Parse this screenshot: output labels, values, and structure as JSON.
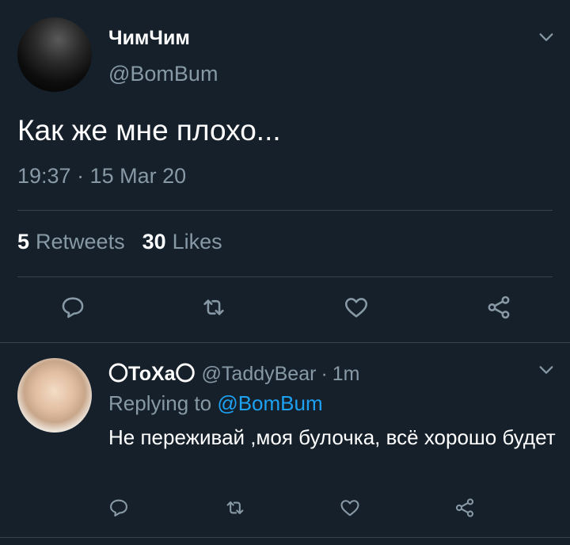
{
  "tweet": {
    "display_name": "ЧимЧим",
    "handle": "@BomBum",
    "text": "Как же мне плохо...",
    "timestamp": "19:37 · 15 Mar 20",
    "retweets_count": "5",
    "retweets_label": "Retweets",
    "likes_count": "30",
    "likes_label": "Likes"
  },
  "reply": {
    "display_name": "〇ТоХа〇",
    "handle": "@TaddyBear",
    "separator": "·",
    "time": "1m",
    "replying_prefix": "Replying to",
    "replying_to": "@BomBum",
    "text": "Не переживай ,моя булочка, всё хорошо будет"
  },
  "icons": {
    "more": "chevron-down-icon",
    "reply": "reply-bubble-icon",
    "retweet": "retweet-icon",
    "like": "heart-icon",
    "share": "share-icon"
  },
  "colors": {
    "background": "#15202b",
    "secondary_text": "#8899a6",
    "accent": "#1da1f2",
    "divider": "#38444d"
  }
}
